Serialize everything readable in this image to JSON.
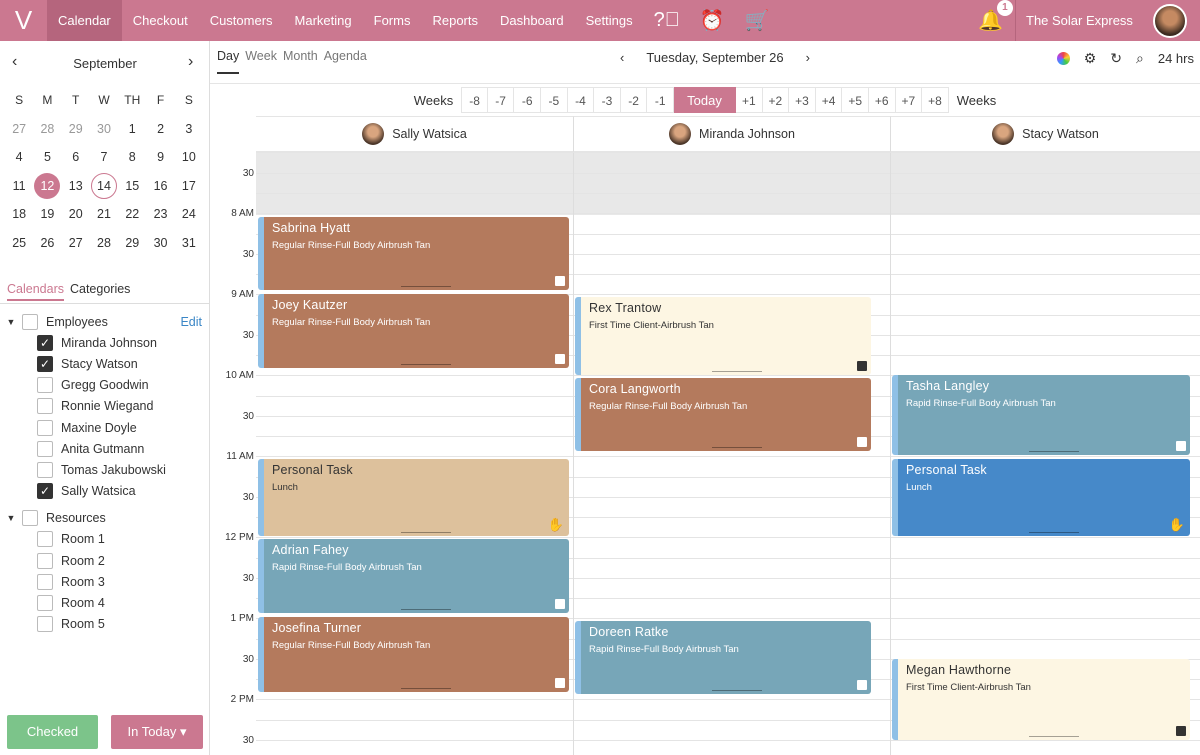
{
  "nav": {
    "items": [
      "Calendar",
      "Checkout",
      "Customers",
      "Marketing",
      "Forms",
      "Reports",
      "Dashboard",
      "Settings"
    ],
    "notifications": "1",
    "business": "The  Solar Express"
  },
  "minical": {
    "month": "September",
    "weekdays": [
      "S",
      "M",
      "T",
      "W",
      "TH",
      "F",
      "S"
    ],
    "weeks": [
      [
        "27",
        "28",
        "29",
        "30",
        "1",
        "2",
        "3"
      ],
      [
        "4",
        "5",
        "6",
        "7",
        "8",
        "9",
        "10"
      ],
      [
        "11",
        "12",
        "13",
        "14",
        "15",
        "16",
        "17"
      ],
      [
        "18",
        "19",
        "20",
        "21",
        "22",
        "23",
        "24"
      ],
      [
        "25",
        "26",
        "27",
        "28",
        "29",
        "30",
        "31"
      ]
    ],
    "selected": "12",
    "today": "14"
  },
  "sidetabs": [
    "Calendars",
    "Categories"
  ],
  "employees": {
    "label": "Employees",
    "edit": "Edit",
    "items": [
      {
        "name": "Miranda Johnson",
        "checked": true
      },
      {
        "name": "Stacy Watson",
        "checked": true
      },
      {
        "name": "Gregg Goodwin",
        "checked": false
      },
      {
        "name": "Ronnie Wiegand",
        "checked": false
      },
      {
        "name": "Maxine Doyle",
        "checked": false
      },
      {
        "name": "Anita Gutmann",
        "checked": false
      },
      {
        "name": "Tomas Jakubowski",
        "checked": false
      },
      {
        "name": "Sally Watsica",
        "checked": true
      }
    ]
  },
  "resources": {
    "label": "Resources",
    "items": [
      "Room 1",
      "Room 2",
      "Room 3",
      "Room 4",
      "Room 5"
    ]
  },
  "buttons": {
    "checked": "Checked",
    "in_today": "In Today"
  },
  "views": [
    "Day",
    "Week",
    "Month",
    "Agenda"
  ],
  "date": "Tuesday, September 26",
  "hours_mode": "24 hrs",
  "weeks": {
    "label": "Weeks",
    "minus": [
      "-8",
      "-7",
      "-6",
      "-5",
      "-4",
      "-3",
      "-2",
      "-1"
    ],
    "today": "Today",
    "plus": [
      "+1",
      "+2",
      "+3",
      "+4",
      "+5",
      "+6",
      "+7",
      "+8"
    ]
  },
  "columns": [
    "Sally Watsica",
    "Miranda Johnson",
    "Stacy Watson"
  ],
  "times": [
    "30",
    "8 AM",
    "30",
    "9 AM",
    "30",
    "10 AM",
    "30",
    "11 AM",
    "30",
    "12 PM",
    "30",
    "1 PM",
    "30",
    "2 PM",
    "30"
  ],
  "events": [
    {
      "name": "Sabrina Hyatt",
      "service": "Regular Rinse-Full Body Airbrush Tan"
    },
    {
      "name": "Joey Kautzer",
      "service": "Regular Rinse-Full Body Airbrush Tan"
    },
    {
      "name": "Personal Task",
      "service": "Lunch"
    },
    {
      "name": "Adrian Fahey",
      "service": "Rapid Rinse-Full Body Airbrush Tan"
    },
    {
      "name": "Josefina Turner",
      "service": "Regular Rinse-Full Body Airbrush Tan"
    },
    {
      "name": "Rex Trantow",
      "service": "First Time Client-Airbrush Tan"
    },
    {
      "name": "Cora Langworth",
      "service": "Regular Rinse-Full Body Airbrush Tan"
    },
    {
      "name": "Doreen Ratke",
      "service": "Rapid Rinse-Full Body Airbrush Tan"
    },
    {
      "name": "Tasha Langley",
      "service": "Rapid Rinse-Full Body Airbrush Tan"
    },
    {
      "name": "Personal Task",
      "service": "Lunch"
    },
    {
      "name": "Megan Hawthorne",
      "service": "First Time Client-Airbrush Tan"
    }
  ]
}
